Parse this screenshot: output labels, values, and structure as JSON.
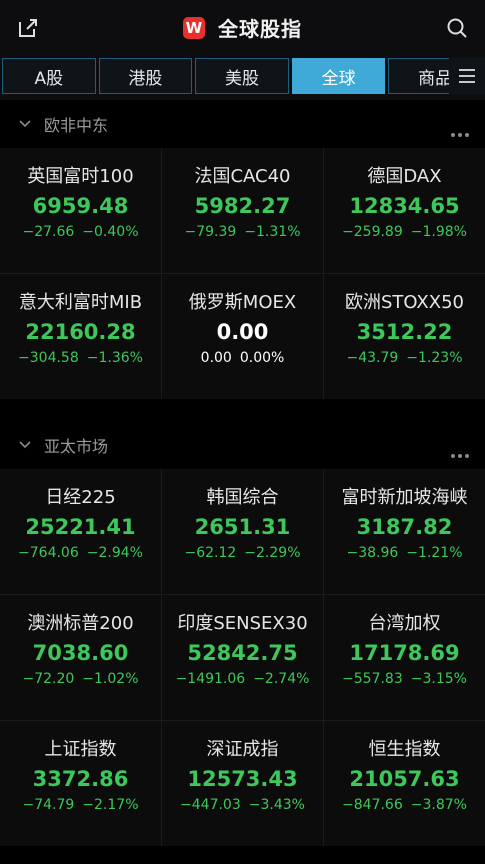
{
  "header": {
    "title": "全球股指",
    "logo_text": "W"
  },
  "tabs": [
    {
      "label": "A股"
    },
    {
      "label": "港股"
    },
    {
      "label": "美股"
    },
    {
      "label": "全球"
    },
    {
      "label": "商品"
    }
  ],
  "active_tab": "全球",
  "colors": {
    "down": "#3ec75a",
    "flat": "#ffffff",
    "accent": "#3fa9d8",
    "logo": "#e8312f"
  },
  "sections": [
    {
      "title": "欧非中东",
      "items": [
        {
          "name": "英国富时100",
          "price": "6959.48",
          "change": "−27.66",
          "pct": "−0.40%",
          "trend": "down"
        },
        {
          "name": "法国CAC40",
          "price": "5982.27",
          "change": "−79.39",
          "pct": "−1.31%",
          "trend": "down"
        },
        {
          "name": "德国DAX",
          "price": "12834.65",
          "change": "−259.89",
          "pct": "−1.98%",
          "trend": "down"
        },
        {
          "name": "意大利富时MIB",
          "price": "22160.28",
          "change": "−304.58",
          "pct": "−1.36%",
          "trend": "down"
        },
        {
          "name": "俄罗斯MOEX",
          "price": "0.00",
          "change": "0.00",
          "pct": "0.00%",
          "trend": "flat"
        },
        {
          "name": "欧洲STOXX50",
          "price": "3512.22",
          "change": "−43.79",
          "pct": "−1.23%",
          "trend": "down"
        }
      ]
    },
    {
      "title": "亚太市场",
      "items": [
        {
          "name": "日经225",
          "price": "25221.41",
          "change": "−764.06",
          "pct": "−2.94%",
          "trend": "down"
        },
        {
          "name": "韩国综合",
          "price": "2651.31",
          "change": "−62.12",
          "pct": "−2.29%",
          "trend": "down"
        },
        {
          "name": "富时新加坡海峡",
          "price": "3187.82",
          "change": "−38.96",
          "pct": "−1.21%",
          "trend": "down"
        },
        {
          "name": "澳洲标普200",
          "price": "7038.60",
          "change": "−72.20",
          "pct": "−1.02%",
          "trend": "down"
        },
        {
          "name": "印度SENSEX30",
          "price": "52842.75",
          "change": "−1491.06",
          "pct": "−2.74%",
          "trend": "down"
        },
        {
          "name": "台湾加权",
          "price": "17178.69",
          "change": "−557.83",
          "pct": "−3.15%",
          "trend": "down"
        },
        {
          "name": "上证指数",
          "price": "3372.86",
          "change": "−74.79",
          "pct": "−2.17%",
          "trend": "down"
        },
        {
          "name": "深证成指",
          "price": "12573.43",
          "change": "−447.03",
          "pct": "−3.43%",
          "trend": "down"
        },
        {
          "name": "恒生指数",
          "price": "21057.63",
          "change": "−847.66",
          "pct": "−3.87%",
          "trend": "down"
        }
      ]
    }
  ]
}
